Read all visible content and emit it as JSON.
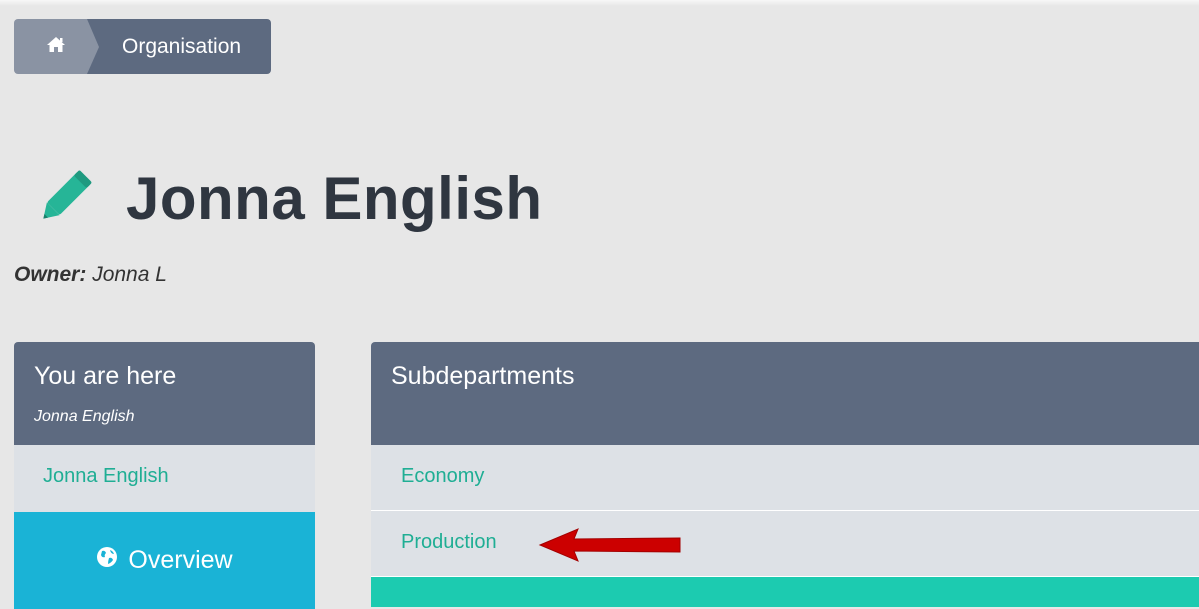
{
  "breadcrumb": {
    "home_icon": "home-icon",
    "current": "Organisation"
  },
  "header": {
    "icon": "pencil-icon",
    "title": "Jonna English",
    "owner_label": "Owner:",
    "owner_value": "Jonna L"
  },
  "location_panel": {
    "title": "You are here",
    "subtitle": "Jonna English",
    "items": [
      {
        "label": "Jonna English"
      }
    ],
    "overview_button": {
      "icon": "globe-icon",
      "label": "Overview"
    }
  },
  "subdepartments_panel": {
    "title": "Subdepartments",
    "items": [
      {
        "label": "Economy"
      },
      {
        "label": "Production"
      }
    ]
  },
  "annotation": {
    "icon": "red-arrow-icon",
    "color": "#cc0000"
  },
  "colors": {
    "header_bg": "#5d6a80",
    "link_green": "#1fae94",
    "overview_cyan": "#1ab3d6",
    "pencil_teal": "#26b597",
    "accent_teal": "#1ccbb0"
  }
}
